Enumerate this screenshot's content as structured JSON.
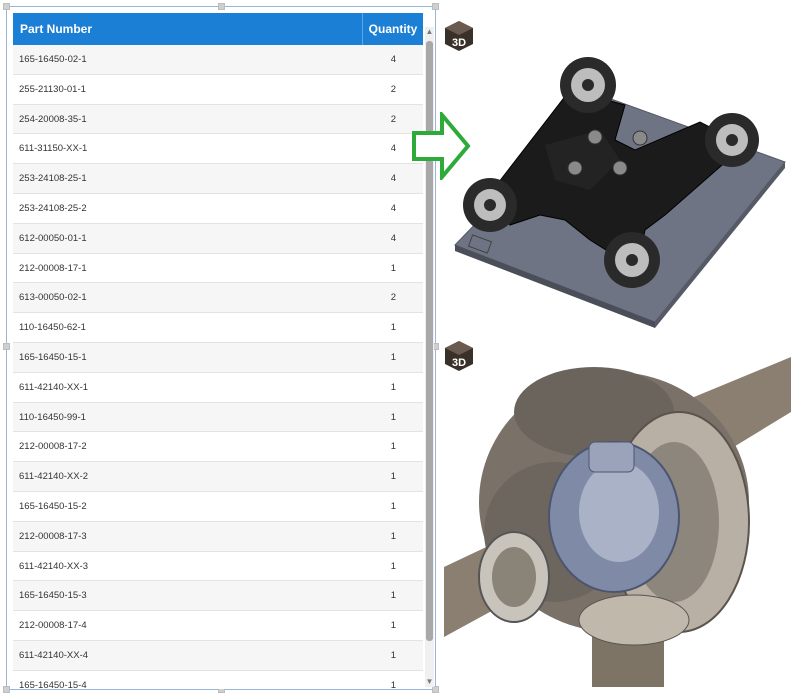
{
  "table": {
    "headers": {
      "part_number": "Part Number",
      "quantity": "Quantity"
    },
    "rows": [
      {
        "part": "165-16450-02-1",
        "qty": "4"
      },
      {
        "part": "255-21130-01-1",
        "qty": "2"
      },
      {
        "part": "254-20008-35-1",
        "qty": "2"
      },
      {
        "part": "611-31150-XX-1",
        "qty": "4"
      },
      {
        "part": "253-24108-25-1",
        "qty": "4"
      },
      {
        "part": "253-24108-25-2",
        "qty": "4"
      },
      {
        "part": "612-00050-01-1",
        "qty": "4"
      },
      {
        "part": "212-00008-17-1",
        "qty": "1"
      },
      {
        "part": "613-00050-02-1",
        "qty": "2"
      },
      {
        "part": "110-16450-62-1",
        "qty": "1"
      },
      {
        "part": "165-16450-15-1",
        "qty": "1"
      },
      {
        "part": "611-42140-XX-1",
        "qty": "1"
      },
      {
        "part": "110-16450-99-1",
        "qty": "1"
      },
      {
        "part": "212-00008-17-2",
        "qty": "1"
      },
      {
        "part": "611-42140-XX-2",
        "qty": "1"
      },
      {
        "part": "165-16450-15-2",
        "qty": "1"
      },
      {
        "part": "212-00008-17-3",
        "qty": "1"
      },
      {
        "part": "611-42140-XX-3",
        "qty": "1"
      },
      {
        "part": "165-16450-15-3",
        "qty": "1"
      },
      {
        "part": "212-00008-17-4",
        "qty": "1"
      },
      {
        "part": "611-42140-XX-4",
        "qty": "1"
      },
      {
        "part": "165-16450-15-4",
        "qty": "1"
      }
    ]
  },
  "badges": {
    "top": "3D",
    "bottom": "3D"
  },
  "colors": {
    "header": "#1c7fd6",
    "arrow": "#2eaa3a",
    "plate": "#6f7484",
    "bracket": "#1b1b1b"
  }
}
